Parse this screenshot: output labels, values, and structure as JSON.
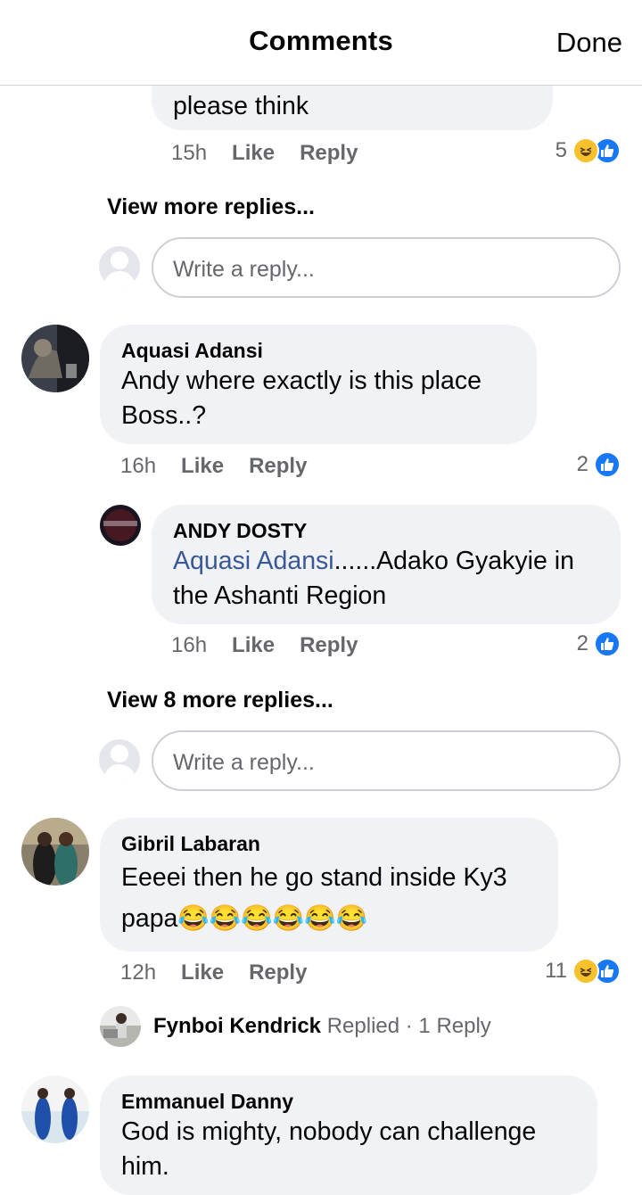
{
  "header": {
    "title": "Comments",
    "done_label": "Done"
  },
  "thread_top": {
    "text": "please think",
    "time": "15h",
    "like_label": "Like",
    "reply_label": "Reply",
    "reaction_count": "5",
    "reaction_icons": [
      "haha-icon",
      "like-icon"
    ]
  },
  "view_more_1": "View more replies...",
  "reply_placeholder_1": "Write a reply...",
  "comment_aquasi": {
    "author": "Aquasi Adansi",
    "text": "Andy where exactly is this place Boss..?",
    "time": "16h",
    "like_label": "Like",
    "reply_label": "Reply",
    "reaction_count": "2",
    "reaction_icons": [
      "like-icon"
    ]
  },
  "reply_andy": {
    "author": "ANDY DOSTY",
    "mention": "Aquasi Adansi",
    "text": "......Adako Gyakyie in the Ashanti Region",
    "time": "16h",
    "like_label": "Like",
    "reply_label": "Reply",
    "reaction_count": "2",
    "reaction_icons": [
      "like-icon"
    ]
  },
  "view_more_2": "View 8 more replies...",
  "reply_placeholder_2": "Write a reply...",
  "comment_gibril": {
    "author": "Gibril Labaran",
    "text_line1": "Eeeei then he go stand inside Ky3",
    "text_line2": "papa",
    "emoji": "😂😂😂😂😂😂",
    "time": "12h",
    "like_label": "Like",
    "reply_label": "Reply",
    "reaction_count": "11",
    "reaction_icons": [
      "haha-icon",
      "like-icon"
    ]
  },
  "replied_summary": {
    "name": "Fynboi Kendrick",
    "action": "Replied",
    "count": "· 1 Reply"
  },
  "comment_emmanuel": {
    "author": "Emmanuel Danny",
    "text": "God is mighty, nobody can challenge him."
  },
  "colors": {
    "bubble": "#f0f2f5",
    "like_blue": "#1877f2",
    "haha_yellow": "#f7c12e",
    "mention": "#385898",
    "muted": "#65676b"
  }
}
